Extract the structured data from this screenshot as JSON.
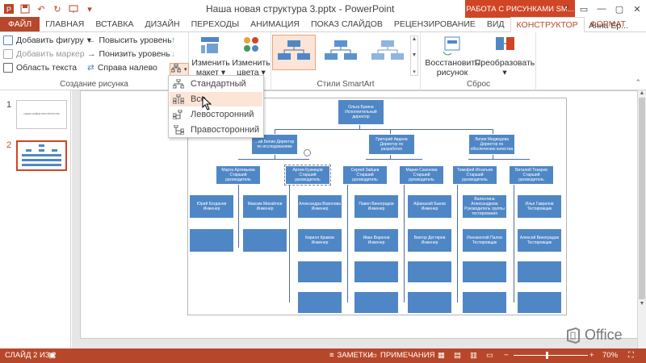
{
  "window": {
    "title": "Наша новая структура 3.pptx - PowerPoint",
    "context_tab_group": "РАБОТА С РИСУНКАМИ SM...",
    "user": "Анна Ер...",
    "controls": [
      "?",
      "▭",
      "—",
      "▢",
      "✕"
    ]
  },
  "tabs": [
    {
      "label": "ФАЙЛ"
    },
    {
      "label": "ГЛАВНАЯ"
    },
    {
      "label": "ВСТАВКА"
    },
    {
      "label": "ДИЗАЙН"
    },
    {
      "label": "ПЕРЕХОДЫ"
    },
    {
      "label": "АНИМАЦИЯ"
    },
    {
      "label": "ПОКАЗ СЛАЙДОВ"
    },
    {
      "label": "РЕЦЕНЗИРОВАНИЕ"
    },
    {
      "label": "ВИД"
    },
    {
      "label": "КОНСТРУКТОР"
    },
    {
      "label": "ФОРМАТ"
    }
  ],
  "ribbon": {
    "create_group": {
      "label": "Создание рисунка",
      "add_shape": "Добавить фигуру",
      "add_bullet": "Добавить маркер",
      "text_pane": "Область текста",
      "promote": "Повысить уровень",
      "demote": "Понизить уровень",
      "rtl": "Справа налево"
    },
    "layouts": {
      "label_1": "Изменить",
      "label_2": "макет"
    },
    "colors": {
      "label_1": "Изменить",
      "label_2": "цвета"
    },
    "styles_group": {
      "label": "Стили SmartArt"
    },
    "reset_group": {
      "label": "Сброс",
      "reset_1": "Восстановить",
      "reset_2": "рисунок",
      "convert": "Преобразовать"
    }
  },
  "layout_menu": {
    "items": [
      {
        "label": "Стандартный"
      },
      {
        "label": "Все"
      },
      {
        "label": "Левосторонний"
      },
      {
        "label": "Правосторонний"
      }
    ],
    "highlighted": "Все"
  },
  "slides_panel": {
    "slides": [
      {
        "num": "1",
        "caption": "НАША НОВАЯ ОРГСТРУКТУРА"
      },
      {
        "num": "2",
        "caption": ""
      }
    ]
  },
  "org_chart": {
    "ceo": "Ольга Букина Исполнительный директор",
    "directors": [
      "...ай Белин Директор по исследованиям",
      "Григорий Авдеев Директор по разработке",
      "Лилия Медведева Директор по обеспечению качества"
    ],
    "seniors": [
      "Марта Артемьева Старший руководитель",
      "Артем Кузнецов Старший руководитель",
      "Сергей Зайцев Старший руководитель",
      "Мария Сазонова Старший руководитель",
      "Тимофей Игнатьев Старший руководитель",
      "Виталий Токарев Старший руководитель"
    ],
    "row3": [
      "Юрий Богданов Инженер",
      "Максим Михайлов Инженер",
      "Александра Воронова Инженер",
      "Павел Виноградов Инженер",
      "Афанасий Быков Инженер",
      "Валентина Александрова Руководитель группы тестирования",
      "Илья Гаврилов Тестировщик"
    ],
    "row4": [
      "Кирилл Крамов Инженер",
      "Иван Воронов Инженер",
      "Виктор Дегтярев Инженер",
      "Иннокентий Палов Тестировщик",
      "Алексей Виноградов Тестировщик"
    ]
  },
  "watermark": "Office",
  "status": {
    "slide": "СЛАЙД 2 ИЗ 2",
    "notes": "ЗАМЕТКИ",
    "comments": "ПРИМЕЧАНИЯ",
    "zoom": "70%"
  },
  "colors": {
    "accent": "#b7472a",
    "context": "#d04525",
    "node": "#4f87c6",
    "highlight": "#fce4d6"
  }
}
